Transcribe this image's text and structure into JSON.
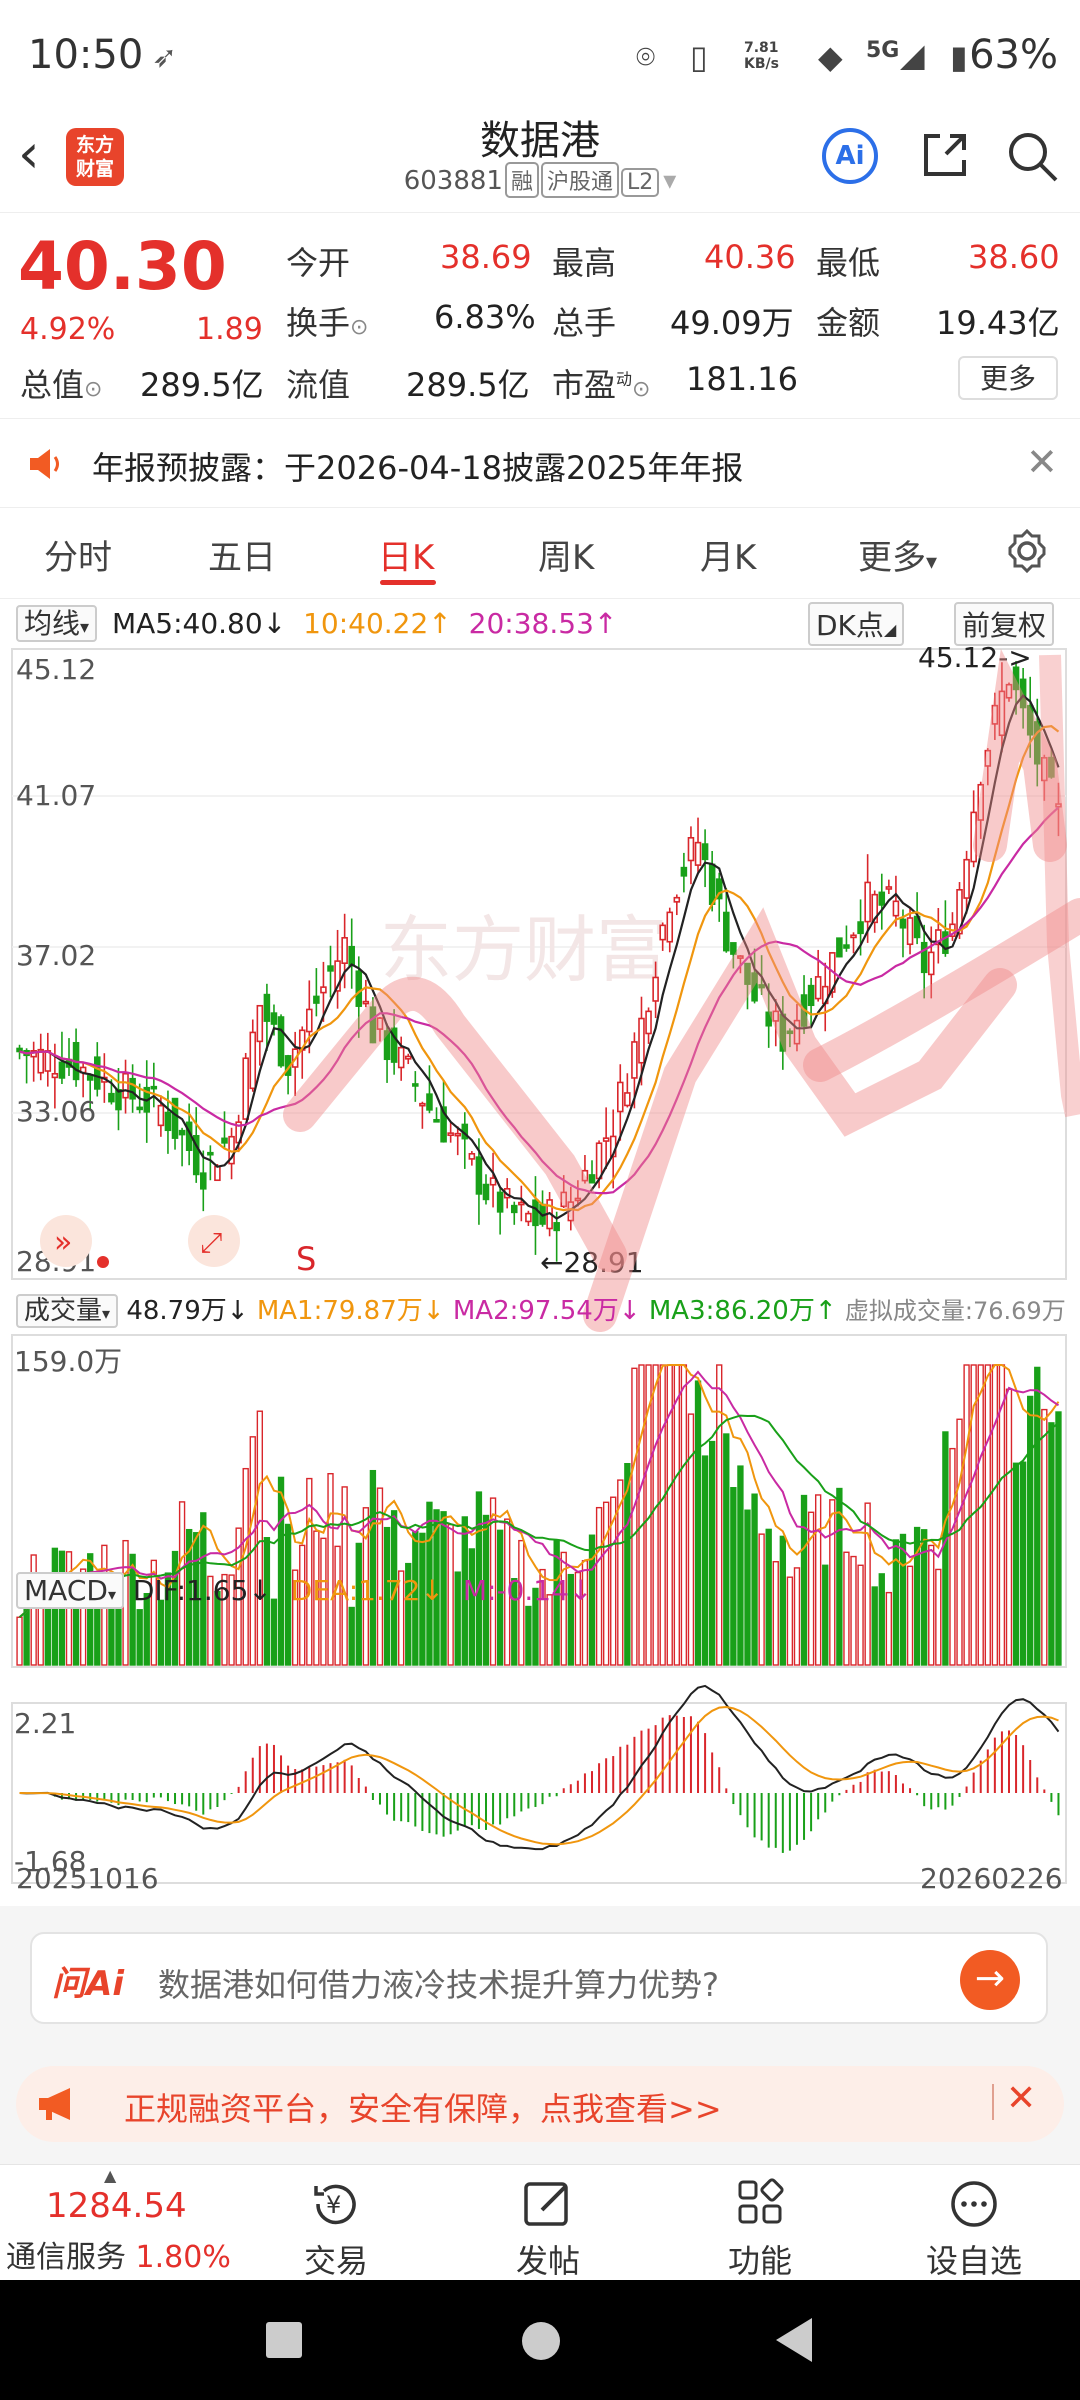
{
  "status_bar": {
    "time": "10:50",
    "speed": "7.81\nKB/s",
    "network": "5G",
    "battery": "63%"
  },
  "header": {
    "title": "数据港",
    "code": "603881",
    "tags": [
      "融",
      "沪股通",
      "L2"
    ],
    "logo_text": "东方\n财富",
    "ai_label": "Ai"
  },
  "quote": {
    "price": "40.30",
    "change_pct": "4.92%",
    "change": "1.89",
    "fields": [
      {
        "label": "今开",
        "value": "38.69",
        "color": "red"
      },
      {
        "label": "最高",
        "value": "40.36",
        "color": "red"
      },
      {
        "label": "最低",
        "value": "38.60",
        "color": "red"
      },
      {
        "label": "换手",
        "value": "6.83%",
        "color": "dark"
      },
      {
        "label": "总手",
        "value": "49.09万",
        "color": "dark"
      },
      {
        "label": "金额",
        "value": "19.43亿",
        "color": "dark"
      },
      {
        "label": "总值",
        "value": "289.5亿",
        "color": "dark"
      },
      {
        "label": "流值",
        "value": "289.5亿",
        "color": "dark"
      },
      {
        "label": "市盈",
        "value": "181.16",
        "color": "dark"
      }
    ],
    "more_label": "更多",
    "pe_sup": "动"
  },
  "notice": {
    "text": "年报预披露：于2026-04-18披露2025年年报"
  },
  "tabs": [
    "分时",
    "五日",
    "日K",
    "周K",
    "月K",
    "更多"
  ],
  "ma": {
    "selector": "均线",
    "ma5": "MA5:40.80",
    "ma5_arrow": "↓",
    "ma10": "10:40.22",
    "ma10_arrow": "↑",
    "ma20": "20:38.53",
    "ma20_arrow": "↑",
    "dk": "DK点",
    "fq": "前复权"
  },
  "kline": {
    "y_labels": [
      "45.12",
      "41.07",
      "37.02",
      "28.91"
    ],
    "overlay_label": "33.06",
    "high_marker": "45.12->",
    "low_marker": "←28.91",
    "s_marker": "S",
    "watermark": "东方财富",
    "colors": {
      "up": "#d9262b",
      "down": "#19a019",
      "ma5": "#222222",
      "ma10": "#f0960e",
      "ma20": "#c92aa3"
    }
  },
  "volume": {
    "selector": "成交量",
    "value": "48.79万",
    "value_arrow": "↓",
    "ma1": "MA1:79.87万",
    "ma1_arrow": "↓",
    "ma2": "MA2:97.54万",
    "ma2_arrow": "↓",
    "ma3": "MA3:86.20万",
    "ma3_arrow": "↑",
    "virtual": "虚拟成交量:76.69万",
    "y_label": "159.0万"
  },
  "macd": {
    "selector": "MACD",
    "dif": "DIF:1.65",
    "dif_arrow": "↓",
    "dea": "DEA:1.72",
    "dea_arrow": "↓",
    "m": "M:-0.14",
    "m_arrow": "↓",
    "y_top": "2.21",
    "y_bottom": "-1.68"
  },
  "dates": {
    "start": "20251016",
    "end": "20260226"
  },
  "ai_bar": {
    "logo": "问Ai",
    "question": "数据港如何借力液冷技术提升算力优势?"
  },
  "ad_bar": {
    "text": "正规融资平台，安全有保障，点我查看>>"
  },
  "toolbar": {
    "index_value": "1284.54",
    "index_name": "通信服务",
    "index_pct": "1.80%",
    "items": [
      "交易",
      "发帖",
      "功能",
      "设自选"
    ]
  }
}
